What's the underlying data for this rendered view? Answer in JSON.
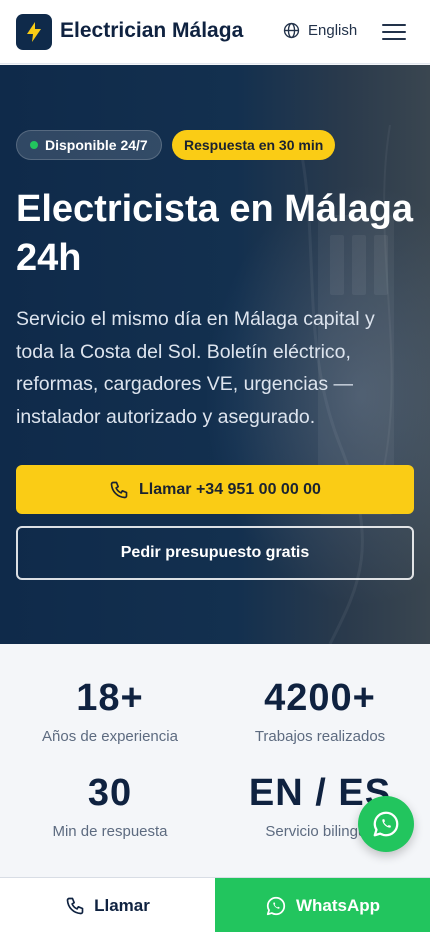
{
  "header": {
    "brand": "Electrician Málaga",
    "logo_icon": "bolt-icon",
    "language": "English",
    "language_icon": "globe-icon",
    "menu_icon": "hamburger-menu-icon"
  },
  "hero": {
    "badge_available": "Disponible 24/7",
    "badge_response": "Respuesta en 30 min",
    "title": "Electricista en Málaga 24h",
    "subtitle": "Servicio el mismo día en Málaga capital y toda la Costa del Sol. Boletín eléctrico, reformas, cargadores VE, urgencias — instalador autorizado y asegurado.",
    "call_button": "Llamar +34 951 00 00 00",
    "quote_button": "Pedir presupuesto gratis"
  },
  "stats": [
    {
      "value": "18+",
      "label": "Años de experiencia"
    },
    {
      "value": "4200+",
      "label": "Trabajos realizados"
    },
    {
      "value": "30",
      "label": "Min de respuesta"
    },
    {
      "value": "EN / ES",
      "label": "Servicio bilingüe"
    }
  ],
  "bottom_bar": {
    "call_label": "Llamar",
    "whatsapp_label": "WhatsApp"
  },
  "colors": {
    "navy": "#0f2a4a",
    "accent_yellow": "#facc15",
    "whatsapp_green": "#22c55e"
  }
}
